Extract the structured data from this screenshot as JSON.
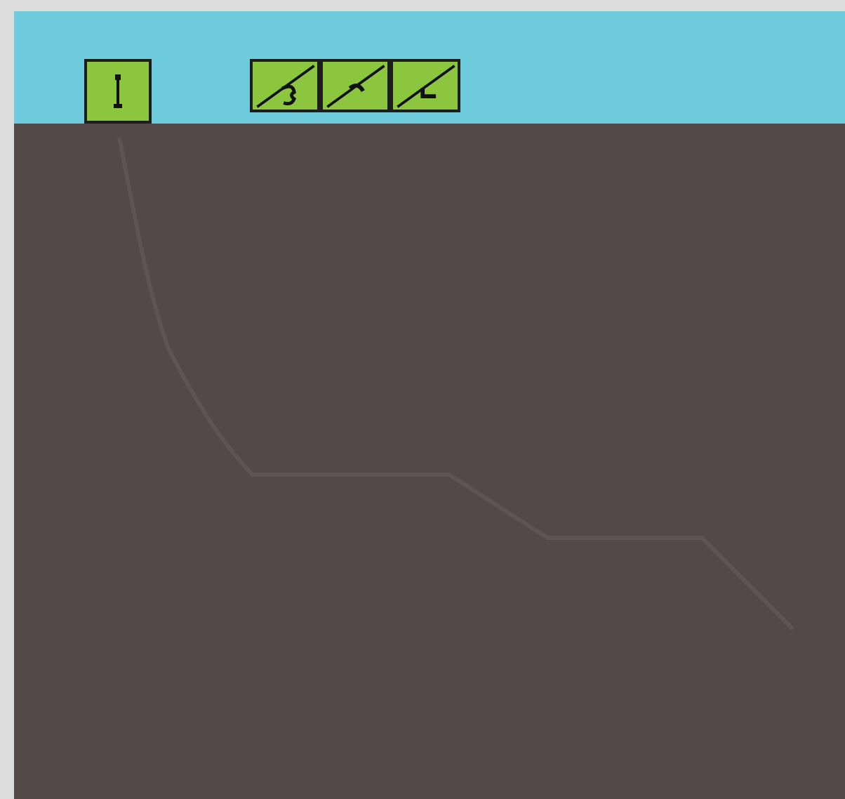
{
  "toolbar": {
    "tiles": [
      {
        "kind": "post"
      },
      {
        "kind": "slope-hook"
      },
      {
        "kind": "slope-bend"
      },
      {
        "kind": "slope-step"
      }
    ]
  }
}
